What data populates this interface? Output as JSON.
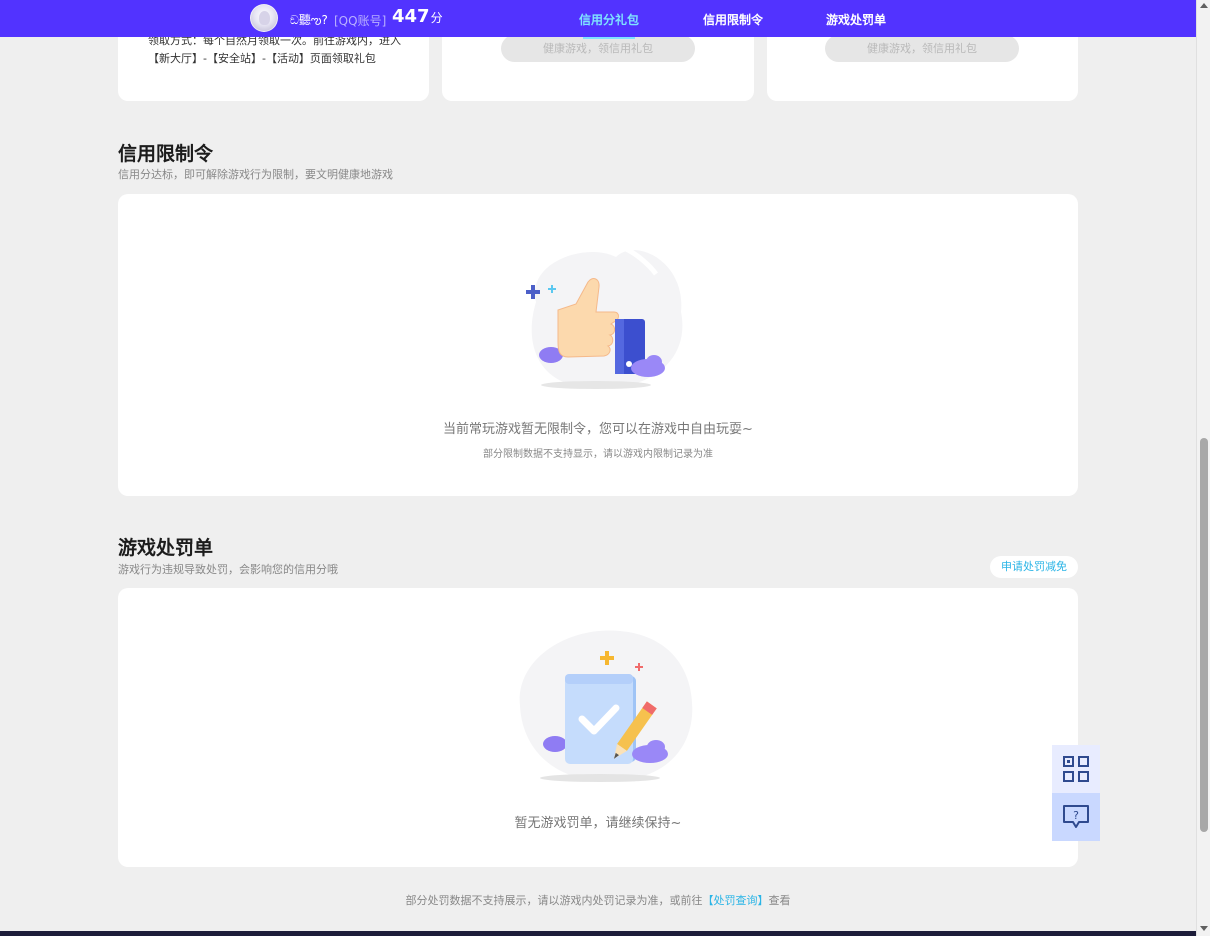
{
  "header": {
    "nickname": "ඞ聽ఌ?",
    "account_tag": "[QQ账号]",
    "score": "447",
    "score_unit": "分",
    "nav": [
      {
        "label": "信用分礼包",
        "active": true
      },
      {
        "label": "信用限制令",
        "active": false
      },
      {
        "label": "游戏处罚单",
        "active": false
      }
    ]
  },
  "gift_cards": {
    "card1_desc": "领取方式：每个自然月领取一次。前往游戏内，进入【新大厅】-【安全站】-【活动】页面领取礼包",
    "card2_button": "健康游戏，领信用礼包",
    "card3_button": "健康游戏，领信用礼包"
  },
  "restriction": {
    "title": "信用限制令",
    "subtitle": "信用分达标，即可解除游戏行为限制，要文明健康地游戏",
    "empty_text": "当前常玩游戏暂无限制令，您可以在游戏中自由玩耍~",
    "empty_note": "部分限制数据不支持显示，请以游戏内限制记录为准"
  },
  "penalty": {
    "title": "游戏处罚单",
    "subtitle": "游戏行为违规导致处罚，会影响您的信用分哦",
    "apply_button": "申请处罚减免",
    "empty_text": "暂无游戏罚单，请继续保持~"
  },
  "footer": {
    "text_before": "部分处罚数据不支持展示，请以游戏内处罚记录为准，或前往",
    "link": "【处罚查询】",
    "text_after": "查看"
  },
  "icons": {
    "qr": "qr-code-icon",
    "help": "help-chat-icon"
  },
  "colors": {
    "nav_bg": "#5233ff",
    "nav_active": "#7fe3ff",
    "link": "#2ab4e6",
    "page_bg": "#efefef"
  }
}
